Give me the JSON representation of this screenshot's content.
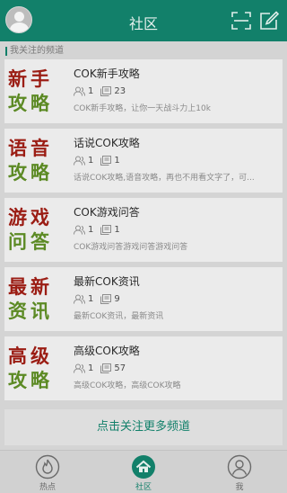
{
  "header": {
    "title": "社区",
    "scan_icon": "scan-icon",
    "edit_icon": "edit-icon",
    "avatar_icon": "user-avatar-icon"
  },
  "section_label": "我关注的频道",
  "channels": [
    {
      "badge_top": "新手",
      "badge_bottom": "攻略",
      "title": "COK新手攻略",
      "members": "1",
      "posts": "23",
      "desc": "COK新手攻略，让你一天战斗力上10k"
    },
    {
      "badge_top": "语音",
      "badge_bottom": "攻略",
      "title": "话说COK攻略",
      "members": "1",
      "posts": "1",
      "desc": "话说COK攻略,语音攻略，再也不用看文字了，可..."
    },
    {
      "badge_top": "游戏",
      "badge_bottom": "问答",
      "title": "COK游戏问答",
      "members": "1",
      "posts": "1",
      "desc": "COK游戏问答游戏问答游戏问答"
    },
    {
      "badge_top": "最新",
      "badge_bottom": "资讯",
      "title": "最新COK资讯",
      "members": "1",
      "posts": "9",
      "desc": "最新COK资讯，最新资讯"
    },
    {
      "badge_top": "高级",
      "badge_bottom": "攻略",
      "title": "高级COK攻略",
      "members": "1",
      "posts": "57",
      "desc": "高级COK攻略，高级COK攻略"
    }
  ],
  "follow_more": "点击关注更多频道",
  "tabs": [
    {
      "label": "热点",
      "icon": "flame-icon",
      "active": false
    },
    {
      "label": "社区",
      "icon": "home-icon",
      "active": true
    },
    {
      "label": "我",
      "icon": "profile-icon",
      "active": false
    }
  ],
  "colors": {
    "brand": "#12806a",
    "badge_top": "#9b1d14",
    "badge_bottom": "#5c8a24"
  }
}
